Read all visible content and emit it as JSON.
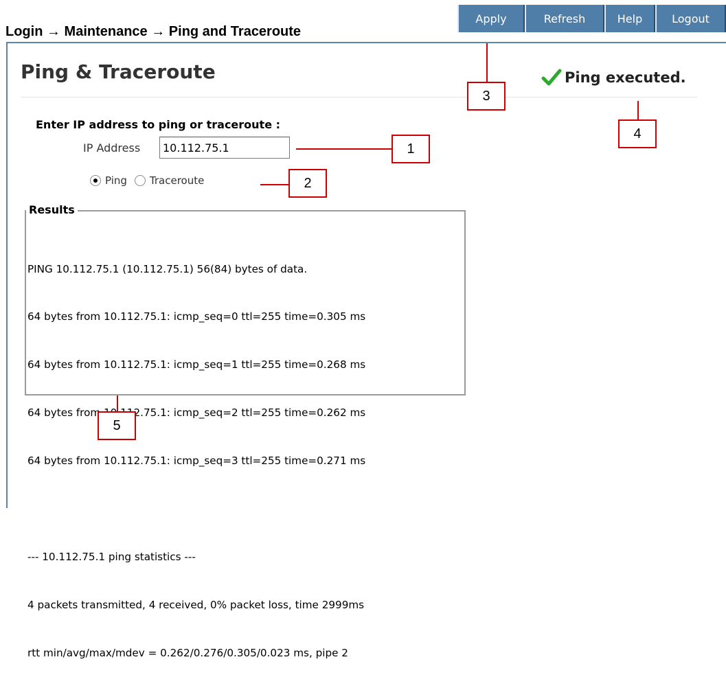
{
  "breadcrumb": "Login → Maintenance → Ping and Traceroute",
  "toolbar": {
    "apply": "Apply",
    "refresh": "Refresh",
    "help": "Help",
    "logout": "Logout"
  },
  "page": {
    "title": "Ping & Traceroute"
  },
  "status": {
    "icon": "check-icon",
    "message": "Ping executed."
  },
  "form": {
    "prompt": "Enter IP address to ping or traceroute :",
    "ip_label": "IP Address",
    "ip_value": "10.112.75.1",
    "radio_ping": "Ping",
    "radio_traceroute": "Traceroute",
    "selected": "Ping"
  },
  "results": {
    "legend": "Results",
    "lines": [
      "PING 10.112.75.1 (10.112.75.1) 56(84) bytes of data.",
      "64 bytes from 10.112.75.1: icmp_seq=0 ttl=255 time=0.305 ms",
      "64 bytes from 10.112.75.1: icmp_seq=1 ttl=255 time=0.268 ms",
      "64 bytes from 10.112.75.1: icmp_seq=2 ttl=255 time=0.262 ms",
      "64 bytes from 10.112.75.1: icmp_seq=3 ttl=255 time=0.271 ms",
      "",
      "--- 10.112.75.1 ping statistics ---",
      "4 packets transmitted, 4 received, 0% packet loss, time 2999ms",
      "rtt min/avg/max/mdev = 0.262/0.276/0.305/0.023 ms, pipe 2"
    ]
  },
  "callouts": {
    "c1": "1",
    "c2": "2",
    "c3": "3",
    "c4": "4",
    "c5": "5"
  },
  "colors": {
    "toolbar": "#4f7ea8",
    "callout": "#cc0000",
    "check": "#2ea82e"
  }
}
